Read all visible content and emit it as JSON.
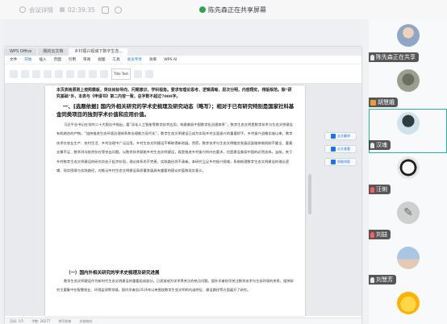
{
  "meeting_bar": {
    "title": "会议详情",
    "elapsed": "02:39:35",
    "sharing_status": "陈先森正在共享屏幕"
  },
  "wps": {
    "tabs": [
      "WPS Office",
      "我的云文档",
      "乡村振兴视域下数字生态..."
    ],
    "menu": [
      "文件",
      "开始",
      "插入",
      "页面",
      "引用",
      "审阅",
      "视图",
      "工具",
      "会员专享",
      "效率",
      "WPS AI"
    ],
    "style_sample": "Title Text",
    "side_buttons": [
      "全文翻译",
      "论文查重",
      "智能排版"
    ],
    "status_text": [
      "页码: 1/5",
      "字数: 26277",
      "拼写检查",
      "文档校对"
    ]
  },
  "document": {
    "note": "本页表格原则上按照模板，突出目标导向，问题意识，学科视角。要求有理论思考、逻辑清晰，层次分明，内容翔实，排版规范。除“研究基础”外，本表与《申请书》第二内容一致，总字数不超过7000字。",
    "heading_1": "一、[选题依据] 国内外相关研究的学术史梳理及研究动态（略写）；相对于已有研究特别是国家社科基金同类项目的独到学术价值和应用价值。",
    "para_1": "习近平总书记在党的二十大报告中指出，要“深化人工智能等数字技术应用，构建美丽中国数字化治理体系”，数字生态文明是数字技术与生态文明建设有机结合的产物。“加快推进生态环境治理体系和治理能力现代化”，数字生态文明建设已成为实现乡村全面振兴的重要抓手。乡村振兴战略实施以来，数字技术在农业生产、农村生活、乡村治理中广泛运用，乡村生态文明建设不断取得新进展。然而，数字技术与生态文明融合发展还面临体制机制不健全、要素支撑不足、数字鸿沟依然存在等突出问题。以数字技术赋能乡村生态文明建设，既是推进乡村振兴的内在要求，也是建设美丽中国的必然选择。当前，关于乡村数字生态文明建设的研究尚处于起步阶段，理论体系尚不完善，实践路径尚不清晰。本研究立足乡村振兴视域，系统梳理数字生态文明建设的理论逻辑、现实困境与实践路径，对推动乡村生态文明建设高质量发展具有重要的理论价值和现实意义。",
    "heading_2": "（一）国内外相关研究的学术史梳理及研究进展",
    "para_2": "数字生态文明建设作为新时代生态文明建设的重要组成部分，已逐渐成为学术界关注的热点问题。国外学者较早关注数字技术与生态环境的关系，相关研究主要集中在智慧农业、环境监测等领域。国内学者自2024年以来围绕数字生态文明的内涵特征、建设路径等方面展开了研究。"
  },
  "participants": [
    {
      "name": "陈先森正在共享",
      "icon": "mic",
      "active": false
    },
    {
      "name": "胡慧娥",
      "icon": "person",
      "active": false
    },
    {
      "name": "汉魂",
      "icon": "mic",
      "active": true
    },
    {
      "name": "汪俐",
      "icon": "muted",
      "active": false
    },
    {
      "name": "刘喆",
      "icon": "muted",
      "active": false
    },
    {
      "name": "刘慧芳",
      "icon": "mic",
      "active": false
    }
  ],
  "colors": {
    "accent": "#1a73e8",
    "active_border": "#26b5a2",
    "heading_blue": "#1a73e8"
  }
}
